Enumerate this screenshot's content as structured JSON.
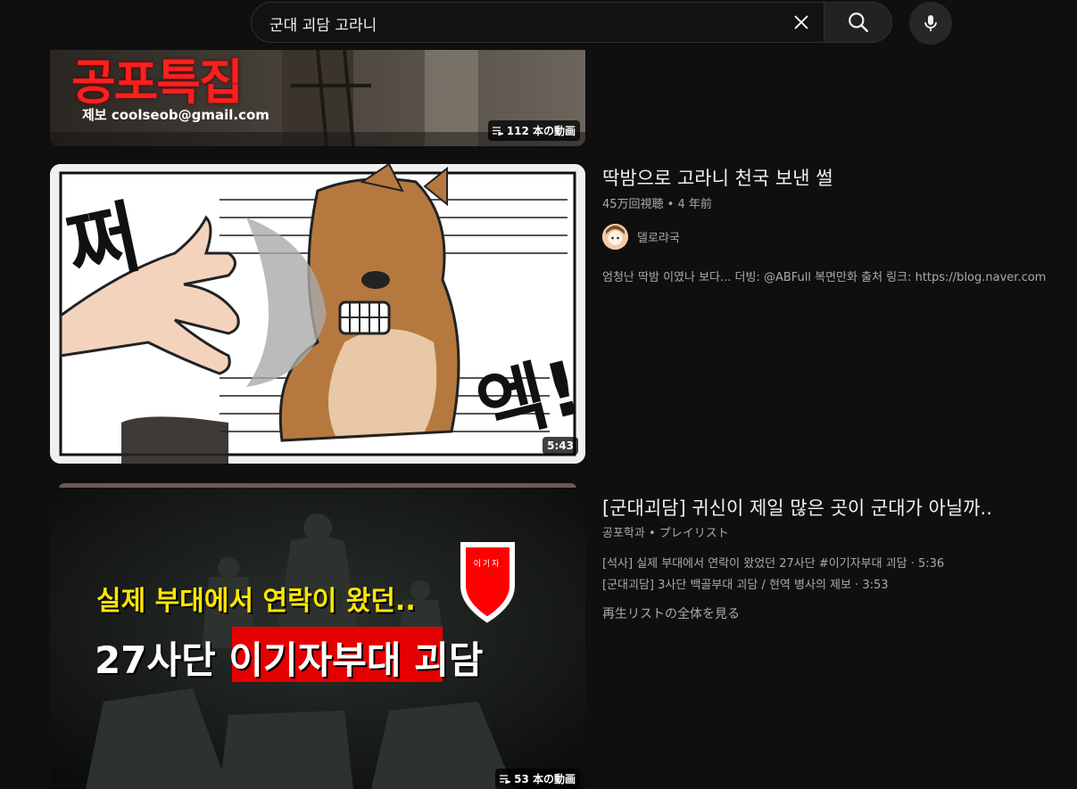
{
  "search": {
    "query": "군대 괴담 고라니"
  },
  "results": [
    {
      "type": "playlist",
      "thumbnail_text": "공포특집",
      "thumbnail_subtext": "제보 coolseob@gmail.com",
      "badge": "112 本の動画"
    },
    {
      "type": "video",
      "title": "딱밤으로 고라니 천국 보낸 썰",
      "views": "45万回視聴",
      "age": "4 年前",
      "channel": "델로랴국",
      "description": "엄청난 딱밤 이였나 보다... 더빙: @ABFull 복면만화 출처 링크: https://blog.naver.com",
      "duration": "5:43",
      "thumbnail_text_left": "쩌",
      "thumbnail_text_right": "엑!"
    },
    {
      "type": "playlist",
      "title": "[군대괴담] 귀신이 제일 많은 곳이 군대가 아닐까..",
      "channel": "공포학과",
      "kind": "プレイリスト",
      "items": [
        {
          "title": "[석사] 실제 부대에서 연락이 왔었던 27사단 #이기자부대 괴담",
          "duration": "5:36"
        },
        {
          "title": "[군대괴담] 3사단 백골부대 괴담 / 현역 병사의 제보",
          "duration": "3:53"
        }
      ],
      "view_all": "再生リストの全体を見る",
      "badge": "53 本の動画",
      "thumbnail_line1": "실제 부대에서 연락이 왔던..",
      "thumbnail_line2a": "27사단 ",
      "thumbnail_line2b": "이기자부대",
      "thumbnail_line2c": " 괴담",
      "thumbnail_emblem": "이기자"
    }
  ],
  "colors": {
    "background": "#0f0f0f",
    "text_primary": "#f1f1f1",
    "text_secondary": "#aaaaaa",
    "thumb_yellow": "#ffe600",
    "thumb_red": "#e40000"
  }
}
